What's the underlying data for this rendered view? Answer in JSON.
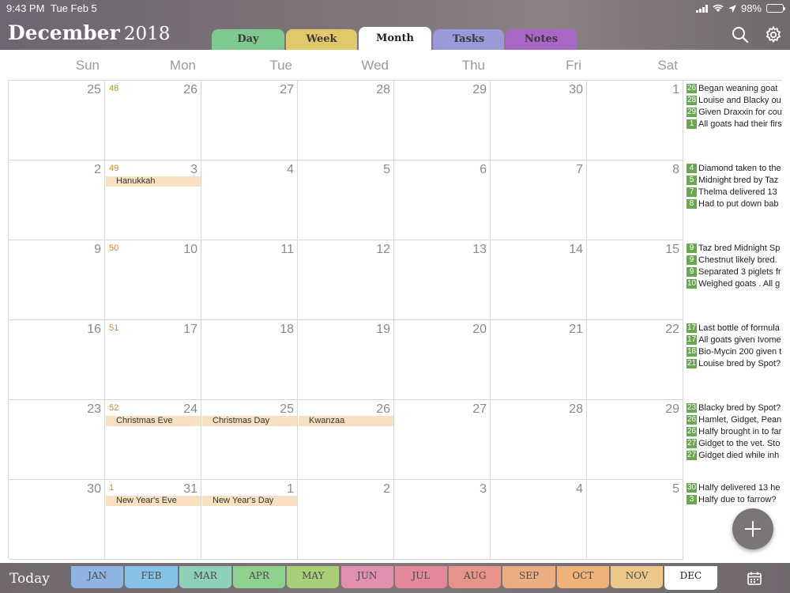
{
  "status": {
    "time": "9:43 PM",
    "date": "Tue Feb 5",
    "battery": "98%"
  },
  "header": {
    "month": "December",
    "year": "2018"
  },
  "view_tabs": [
    {
      "label": "Day",
      "color": "#7ec98f"
    },
    {
      "label": "Week",
      "color": "#e1c86a"
    },
    {
      "label": "Month",
      "color": "#ffffff"
    },
    {
      "label": "Tasks",
      "color": "#9b9ad9"
    },
    {
      "label": "Notes",
      "color": "#a866c6"
    }
  ],
  "active_view": "Month",
  "day_names": [
    "Sun",
    "Mon",
    "Tue",
    "Wed",
    "Thu",
    "Fri",
    "Sat"
  ],
  "weeks": [
    {
      "week_no": "48",
      "days": [
        "25",
        "26",
        "27",
        "28",
        "29",
        "30",
        "1"
      ],
      "events": [],
      "notes": [
        {
          "d": "26",
          "t": "Began weaning goat"
        },
        {
          "d": "28",
          "t": "Louise and Blacky ou"
        },
        {
          "d": "29",
          "t": "Given Draxxin for cou"
        },
        {
          "d": "1",
          "t": "All goats had their firs"
        }
      ]
    },
    {
      "week_no": "49",
      "days": [
        "2",
        "3",
        "4",
        "5",
        "6",
        "7",
        "8"
      ],
      "events": [
        {
          "col": 1,
          "label": "Hanukkah"
        }
      ],
      "notes": [
        {
          "d": "4",
          "t": "Diamond taken to the"
        },
        {
          "d": "5",
          "t": "Midnight bred by Taz"
        },
        {
          "d": "7",
          "t": "Thelma delivered 13"
        },
        {
          "d": "8",
          "t": "Had to put down bab"
        }
      ]
    },
    {
      "week_no": "50",
      "days": [
        "9",
        "10",
        "11",
        "12",
        "13",
        "14",
        "15"
      ],
      "events": [],
      "notes": [
        {
          "d": "9",
          "t": "Taz bred Midnight Sp"
        },
        {
          "d": "9",
          "t": "Chestnut likely bred."
        },
        {
          "d": "9",
          "t": "Separated 3 piglets fr"
        },
        {
          "d": "10",
          "t": "Weighed goats . All g"
        }
      ]
    },
    {
      "week_no": "51",
      "days": [
        "16",
        "17",
        "18",
        "19",
        "20",
        "21",
        "22"
      ],
      "events": [],
      "notes": [
        {
          "d": "17",
          "t": "Last bottle of formula"
        },
        {
          "d": "17",
          "t": "All goats given Ivome"
        },
        {
          "d": "18",
          "t": "Bio-Mycin 200 given t"
        },
        {
          "d": "21",
          "t": "Louise bred by Spot?"
        }
      ]
    },
    {
      "week_no": "52",
      "days": [
        "23",
        "24",
        "25",
        "26",
        "27",
        "28",
        "29"
      ],
      "events": [
        {
          "col": 1,
          "label": "Christmas Eve"
        },
        {
          "col": 2,
          "label": "Christmas Day"
        },
        {
          "col": 3,
          "label": "Kwanzaa"
        }
      ],
      "notes": [
        {
          "d": "23",
          "t": "Blacky bred by Spot?"
        },
        {
          "d": "26",
          "t": "Hamlet, Gidget, Pean"
        },
        {
          "d": "26",
          "t": "Halfy brought in to far"
        },
        {
          "d": "27",
          "t": "Gidget to the vet. Sto"
        },
        {
          "d": "27",
          "t": "Gidget died while inh"
        }
      ]
    },
    {
      "week_no": "1",
      "days": [
        "30",
        "31",
        "1",
        "2",
        "3",
        "4",
        "5"
      ],
      "events": [
        {
          "col": 1,
          "label": "New Year's Eve"
        },
        {
          "col": 2,
          "label": "New Year's Day"
        }
      ],
      "notes": [
        {
          "d": "30",
          "t": "Halfy delivered 13 he"
        },
        {
          "d": "3",
          "t": "Halfy due to farrow?"
        }
      ]
    }
  ],
  "footer": {
    "today_label": "Today",
    "months": [
      {
        "label": "JAN",
        "color": "#8fb4e3"
      },
      {
        "label": "FEB",
        "color": "#86c2e6"
      },
      {
        "label": "MAR",
        "color": "#8fd0b9"
      },
      {
        "label": "APR",
        "color": "#8fd08f"
      },
      {
        "label": "MAY",
        "color": "#a8cf78"
      },
      {
        "label": "JUN",
        "color": "#e08fb0"
      },
      {
        "label": "JUL",
        "color": "#e3899a"
      },
      {
        "label": "AUG",
        "color": "#e6938a"
      },
      {
        "label": "SEP",
        "color": "#edad83"
      },
      {
        "label": "OCT",
        "color": "#eeb27a"
      },
      {
        "label": "NOV",
        "color": "#edc789"
      },
      {
        "label": "DEC",
        "color": "#ffffff"
      }
    ],
    "active_month": "DEC"
  },
  "icons": [
    "search-icon",
    "gear-icon",
    "add-icon",
    "calendar-icon",
    "wifi-icon",
    "signal-icon",
    "battery-icon",
    "location-icon"
  ]
}
